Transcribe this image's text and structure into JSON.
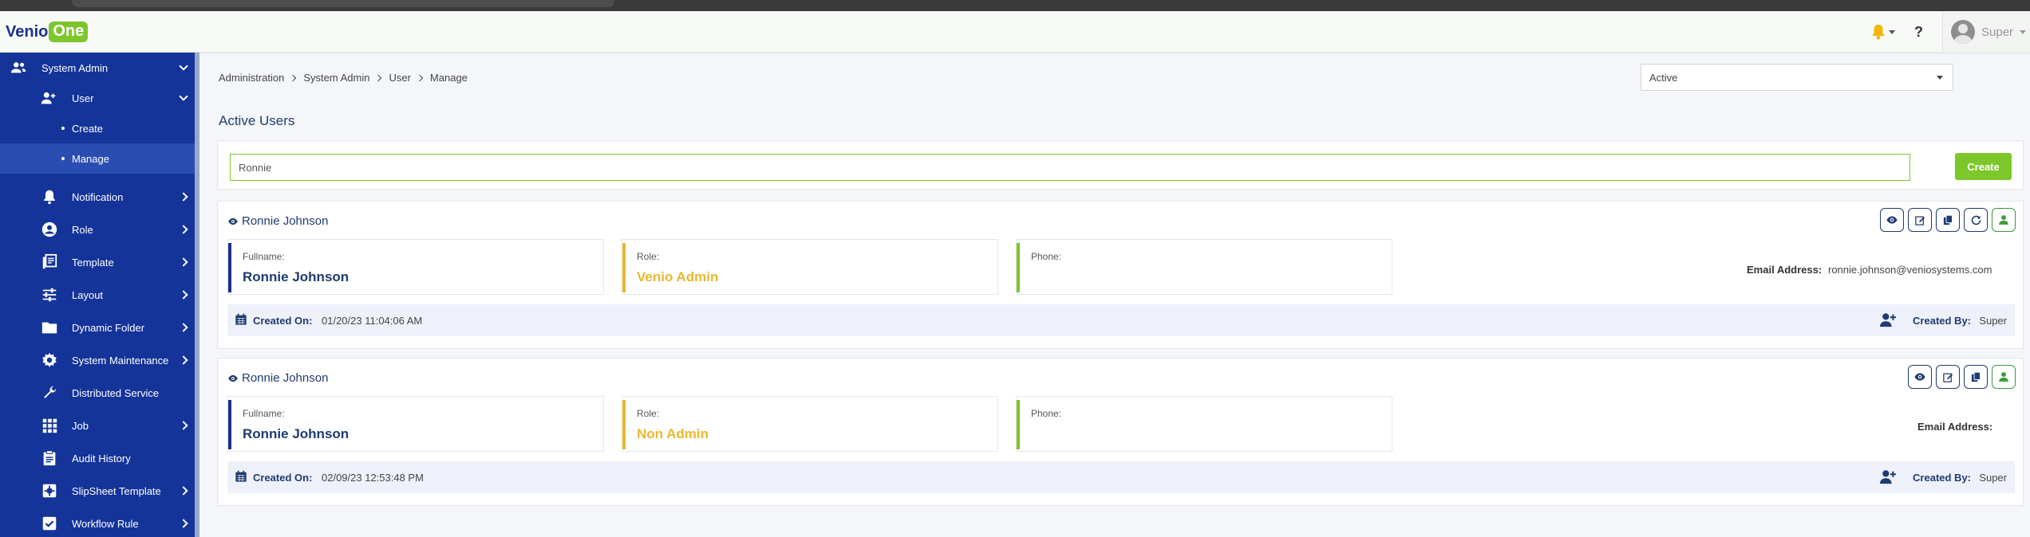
{
  "app": {
    "logo_primary": "Venio",
    "logo_secondary": "One",
    "user_name": "Super",
    "help_label": "?"
  },
  "sidebar": {
    "items": [
      {
        "label": "System Admin",
        "icon": "users-icon",
        "expanded": true
      },
      {
        "label": "User",
        "icon": "user-add-icon",
        "expanded": true
      },
      {
        "label": "Create"
      },
      {
        "label": "Manage",
        "active": true
      },
      {
        "label": "Notification",
        "icon": "bell-icon"
      },
      {
        "label": "Role",
        "icon": "account-circle-icon"
      },
      {
        "label": "Template",
        "icon": "template-icon"
      },
      {
        "label": "Layout",
        "icon": "sliders-icon"
      },
      {
        "label": "Dynamic Folder",
        "icon": "folder-icon"
      },
      {
        "label": "System Maintenance",
        "icon": "gear-icon"
      },
      {
        "label": "Distributed Service",
        "icon": "wrench-icon"
      },
      {
        "label": "Job",
        "icon": "grid-icon"
      },
      {
        "label": "Audit History",
        "icon": "clipboard-icon"
      },
      {
        "label": "SlipSheet Template",
        "icon": "slipsheet-icon"
      },
      {
        "label": "Workflow Rule",
        "icon": "checkbox-icon"
      }
    ]
  },
  "breadcrumb": [
    "Administration",
    "System Admin",
    "User",
    "Manage"
  ],
  "status_filter": {
    "selected": "Active"
  },
  "page_title": "Active Users",
  "search": {
    "value": "Ronnie"
  },
  "create_label": "Create",
  "labels": {
    "fullname": "Fullname:",
    "role": "Role:",
    "phone": "Phone:",
    "email": "Email Address:",
    "created_on": "Created On:",
    "created_by": "Created By:"
  },
  "users": [
    {
      "name": "Ronnie Johnson",
      "fullname": "Ronnie Johnson",
      "role": "Venio Admin",
      "phone": "",
      "email": "ronnie.johnson@veniosystems.com",
      "created_on": "01/20/23 11:04:06 AM",
      "created_by": "Super",
      "actions": [
        "view-icon",
        "edit-icon",
        "copy-icon",
        "reset-icon",
        "user-status-icon"
      ]
    },
    {
      "name": "Ronnie Johnson",
      "fullname": "Ronnie Johnson",
      "role": "Non Admin",
      "phone": "",
      "email": "",
      "created_on": "02/09/23 12:53:48 PM",
      "created_by": "Super",
      "actions": [
        "view-icon",
        "edit-icon",
        "copy-icon",
        "user-status-icon"
      ]
    }
  ],
  "colors": {
    "sidebar_bg": "#14349a",
    "accent_green": "#7dc72a",
    "navy": "#1f3b70",
    "role_gold": "#e8b830"
  }
}
